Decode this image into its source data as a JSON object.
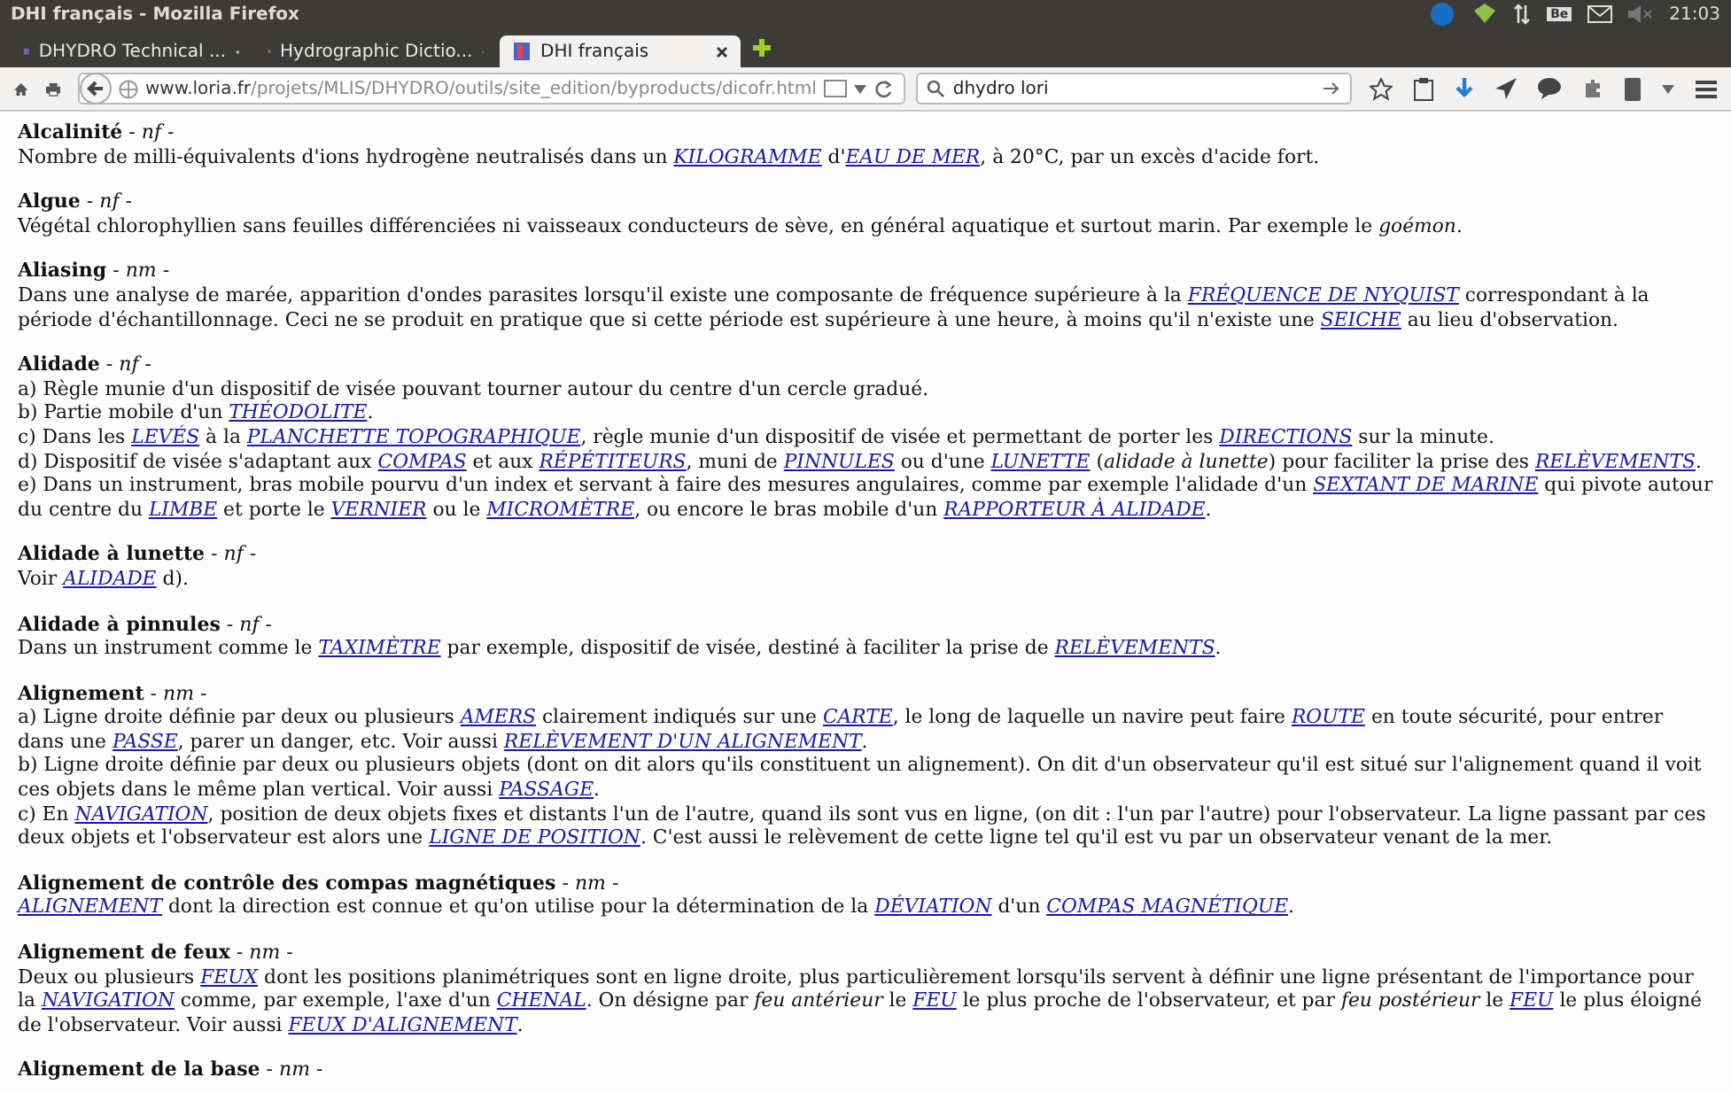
{
  "window": {
    "title": "DHI français - Mozilla Firefox",
    "clock": "21:03",
    "tray_badge": "Be"
  },
  "tabs": [
    {
      "label": "DHYDRO Technical ...",
      "selected": false
    },
    {
      "label": "Hydrographic Dictio...",
      "selected": false
    },
    {
      "label": "DHI français",
      "selected": true
    }
  ],
  "toolbar": {
    "url_host": "www.loria.fr",
    "url_path": "/projets/MLIS/DHYDRO/outils/site_edition/byproducts/dicofr.html",
    "search_value": "dhydro lori"
  },
  "entries": [
    {
      "term": "Alcalinité",
      "pos": "- *nf* -",
      "paragraphs": [
        [
          {
            "kind": "text",
            "text": "Nombre de milli-équivalents d'ions hydrogène neutralisés dans un "
          },
          {
            "kind": "link",
            "text": "KILOGRAMME"
          },
          {
            "kind": "text",
            "text": " d'"
          },
          {
            "kind": "link",
            "text": "EAU DE MER"
          },
          {
            "kind": "text",
            "text": ", à 20°C, par un excès d'acide fort."
          }
        ]
      ]
    },
    {
      "term": "Algue",
      "pos": "- *nf* -",
      "paragraphs": [
        [
          {
            "kind": "text",
            "text": "Végétal chlorophyllien sans feuilles différenciées ni vaisseaux conducteurs de sève, en général aquatique et surtout marin. Par exemple le "
          },
          {
            "kind": "italic",
            "text": "goémon"
          },
          {
            "kind": "text",
            "text": "."
          }
        ]
      ]
    },
    {
      "term": "Aliasing",
      "pos": "- *nm* -",
      "paragraphs": [
        [
          {
            "kind": "text",
            "text": "Dans une analyse de marée, apparition d'ondes parasites lorsqu'il existe une composante de fréquence supérieure à la "
          },
          {
            "kind": "link",
            "text": "FRÉQUENCE DE NYQUIST"
          },
          {
            "kind": "text",
            "text": " correspondant à la période d'échantillonnage. Ceci ne se produit en pratique que si cette période est supérieure à une heure, à moins qu'il n'existe une "
          },
          {
            "kind": "link",
            "text": "SEICHE"
          },
          {
            "kind": "text",
            "text": " au lieu d'observation."
          }
        ]
      ]
    },
    {
      "term": "Alidade",
      "pos": "- *nf* -",
      "paragraphs": [
        [
          {
            "kind": "text",
            "text": "a) Règle munie d'un dispositif de visée pouvant tourner autour du centre d'un cercle gradué."
          }
        ],
        [
          {
            "kind": "text",
            "text": "b) Partie mobile d'un "
          },
          {
            "kind": "link",
            "text": "THÉODOLITE"
          },
          {
            "kind": "text",
            "text": "."
          }
        ],
        [
          {
            "kind": "text",
            "text": "c) Dans les "
          },
          {
            "kind": "link",
            "text": "LEVÉS"
          },
          {
            "kind": "text",
            "text": " à la "
          },
          {
            "kind": "link",
            "text": "PLANCHETTE TOPOGRAPHIQUE"
          },
          {
            "kind": "text",
            "text": ", règle munie d'un dispositif de visée et permettant de porter les "
          },
          {
            "kind": "link",
            "text": "DIRECTIONS"
          },
          {
            "kind": "text",
            "text": " sur la minute."
          }
        ],
        [
          {
            "kind": "text",
            "text": "d) Dispositif de visée s'adaptant aux "
          },
          {
            "kind": "link",
            "text": "COMPAS"
          },
          {
            "kind": "text",
            "text": " et aux "
          },
          {
            "kind": "link",
            "text": "RÉPÉTITEURS"
          },
          {
            "kind": "text",
            "text": ", muni de "
          },
          {
            "kind": "link",
            "text": "PINNULES"
          },
          {
            "kind": "text",
            "text": " ou d'une "
          },
          {
            "kind": "link",
            "text": "LUNETTE"
          },
          {
            "kind": "text",
            "text": " ("
          },
          {
            "kind": "italic",
            "text": "alidade à lunette"
          },
          {
            "kind": "text",
            "text": ") pour faciliter la prise des "
          },
          {
            "kind": "link",
            "text": "RELÈVEMENTS"
          },
          {
            "kind": "text",
            "text": "."
          }
        ],
        [
          {
            "kind": "text",
            "text": "e) Dans un instrument, bras mobile pourvu d'un index et servant à faire des mesures angulaires, comme par exemple l'alidade d'un "
          },
          {
            "kind": "link",
            "text": "SEXTANT DE MARINE"
          },
          {
            "kind": "text",
            "text": " qui pivote autour du centre du "
          },
          {
            "kind": "link",
            "text": "LIMBE"
          },
          {
            "kind": "text",
            "text": " et porte le "
          },
          {
            "kind": "link",
            "text": "VERNIER"
          },
          {
            "kind": "text",
            "text": " ou le "
          },
          {
            "kind": "link",
            "text": "MICROMÈTRE"
          },
          {
            "kind": "text",
            "text": ", ou encore le bras mobile d'un "
          },
          {
            "kind": "link",
            "text": "RAPPORTEUR À ALIDADE"
          },
          {
            "kind": "text",
            "text": "."
          }
        ]
      ]
    },
    {
      "term": "Alidade à lunette",
      "pos": "- *nf* -",
      "paragraphs": [
        [
          {
            "kind": "text",
            "text": "Voir "
          },
          {
            "kind": "link",
            "text": "ALIDADE"
          },
          {
            "kind": "text",
            "text": " d)."
          }
        ]
      ]
    },
    {
      "term": "Alidade à pinnules",
      "pos": "- *nf* -",
      "paragraphs": [
        [
          {
            "kind": "text",
            "text": "Dans un instrument comme le "
          },
          {
            "kind": "link",
            "text": "TAXIMÈTRE"
          },
          {
            "kind": "text",
            "text": " par exemple, dispositif de visée, destiné à faciliter la prise de "
          },
          {
            "kind": "link",
            "text": "RELÈVEMENTS"
          },
          {
            "kind": "text",
            "text": "."
          }
        ]
      ]
    },
    {
      "term": "Alignement",
      "pos": "- *nm* -",
      "paragraphs": [
        [
          {
            "kind": "text",
            "text": "a) Ligne droite définie par deux ou plusieurs "
          },
          {
            "kind": "link",
            "text": "AMERS"
          },
          {
            "kind": "text",
            "text": " clairement indiqués sur une "
          },
          {
            "kind": "link",
            "text": "CARTE"
          },
          {
            "kind": "text",
            "text": ", le long de laquelle un navire peut faire "
          },
          {
            "kind": "link",
            "text": "ROUTE"
          },
          {
            "kind": "text",
            "text": " en toute sécurité, pour entrer dans une "
          },
          {
            "kind": "link",
            "text": "PASSE"
          },
          {
            "kind": "text",
            "text": ", parer un danger, etc. Voir aussi "
          },
          {
            "kind": "link",
            "text": "RELÈVEMENT D'UN ALIGNEMENT"
          },
          {
            "kind": "text",
            "text": "."
          }
        ],
        [
          {
            "kind": "text",
            "text": "b) Ligne droite définie par deux ou plusieurs objets (dont on dit alors qu'ils constituent un alignement). On dit d'un observateur qu'il est situé sur l'alignement quand il voit ces objets dans le même plan vertical. Voir aussi "
          },
          {
            "kind": "link",
            "text": "PASSAGE"
          },
          {
            "kind": "text",
            "text": "."
          }
        ],
        [
          {
            "kind": "text",
            "text": "c) En "
          },
          {
            "kind": "link",
            "text": "NAVIGATION"
          },
          {
            "kind": "text",
            "text": ", position de deux objets fixes et distants l'un de l'autre, quand ils sont vus en ligne, (on dit : l'un par l'autre) pour l'observateur. La ligne passant par ces deux objets et l'observateur est alors une "
          },
          {
            "kind": "link",
            "text": "LIGNE DE POSITION"
          },
          {
            "kind": "text",
            "text": ". C'est aussi le relèvement de cette ligne tel qu'il est vu par un observateur venant de la mer."
          }
        ]
      ]
    },
    {
      "term": "Alignement de contrôle des compas magnétiques",
      "pos": "- *nm* -",
      "paragraphs": [
        [
          {
            "kind": "link",
            "text": "ALIGNEMENT"
          },
          {
            "kind": "text",
            "text": " dont la direction est connue et qu'on utilise pour la détermination de la "
          },
          {
            "kind": "link",
            "text": "DÉVIATION"
          },
          {
            "kind": "text",
            "text": " d'un "
          },
          {
            "kind": "link",
            "text": "COMPAS MAGNÉTIQUE"
          },
          {
            "kind": "text",
            "text": "."
          }
        ]
      ]
    },
    {
      "term": "Alignement de feux",
      "pos": "- *nm* -",
      "paragraphs": [
        [
          {
            "kind": "text",
            "text": "Deux ou plusieurs "
          },
          {
            "kind": "link",
            "text": "FEUX"
          },
          {
            "kind": "text",
            "text": " dont les positions planimétriques sont en ligne droite, plus particulièrement lorsqu'ils servent à définir une ligne présentant de l'importance pour la "
          },
          {
            "kind": "link",
            "text": "NAVIGATION"
          },
          {
            "kind": "text",
            "text": " comme, par exemple, l'axe d'un "
          },
          {
            "kind": "link",
            "text": "CHENAL"
          },
          {
            "kind": "text",
            "text": ". On désigne par "
          },
          {
            "kind": "italic",
            "text": "feu antérieur"
          },
          {
            "kind": "text",
            "text": " le "
          },
          {
            "kind": "link",
            "text": "FEU"
          },
          {
            "kind": "text",
            "text": " le plus proche de l'observateur, et par "
          },
          {
            "kind": "italic",
            "text": "feu postérieur"
          },
          {
            "kind": "text",
            "text": " le "
          },
          {
            "kind": "link",
            "text": "FEU"
          },
          {
            "kind": "text",
            "text": " le plus éloigné de l'observateur. Voir aussi "
          },
          {
            "kind": "link",
            "text": "FEUX D'ALIGNEMENT"
          },
          {
            "kind": "text",
            "text": "."
          }
        ]
      ]
    },
    {
      "term": "Alignement de la base",
      "pos": "- *nm* -"
    }
  ]
}
